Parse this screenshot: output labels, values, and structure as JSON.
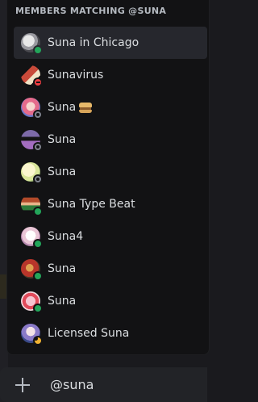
{
  "autocomplete": {
    "header": "MEMBERS MATCHING @SUNA",
    "members": [
      {
        "name": "Suna in Chicago",
        "status": "online",
        "avatar": "avatar-gray-sketch",
        "selected": true
      },
      {
        "name": "Sunavirus",
        "status": "dnd",
        "avatar": "avatar-red-character"
      },
      {
        "name": "Suna",
        "status": "offline",
        "avatar": "avatar-pink-character",
        "emoji": "sandwich-icon"
      },
      {
        "name": "Suna",
        "status": "offline",
        "avatar": "avatar-sunglasses"
      },
      {
        "name": "Suna",
        "status": "offline",
        "avatar": "avatar-yellow-green"
      },
      {
        "name": "Suna Type Beat",
        "status": "online",
        "avatar": "avatar-pixel-character"
      },
      {
        "name": "Suna4",
        "status": "online",
        "avatar": "avatar-white-pink"
      },
      {
        "name": "Suna",
        "status": "online",
        "avatar": "avatar-red-bird"
      },
      {
        "name": "Suna",
        "status": "online",
        "avatar": "avatar-pink-red"
      },
      {
        "name": "Licensed Suna",
        "status": "idle",
        "avatar": "avatar-anime-blue"
      }
    ]
  },
  "composer": {
    "value": "@suna"
  },
  "colors": {
    "online": "#23a55a",
    "dnd": "#f23f43",
    "idle": "#f0b232",
    "offline": "#80848e",
    "selected_row": "#26272d"
  }
}
